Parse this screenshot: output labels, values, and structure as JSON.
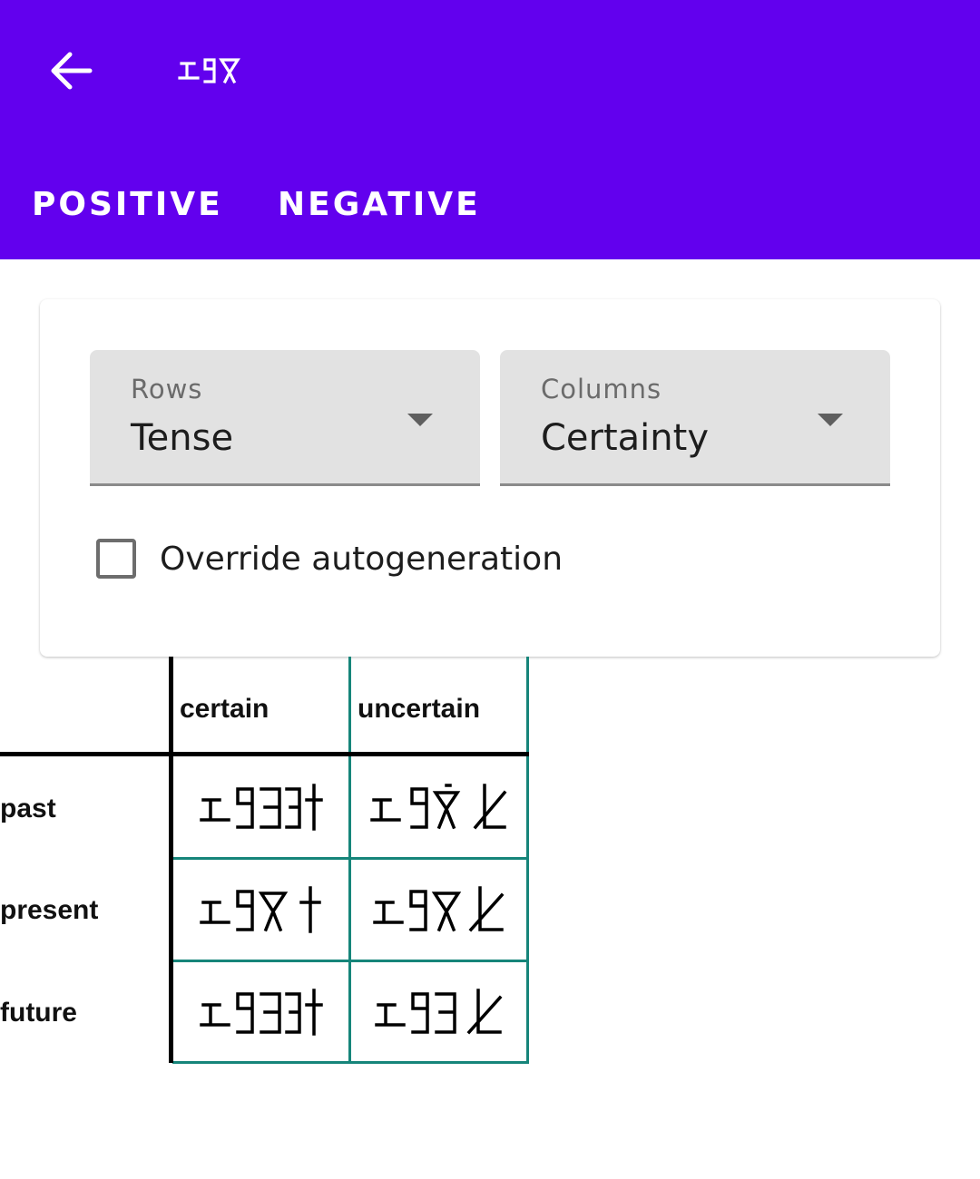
{
  "appbar": {
    "title_glyph": "ᥓᥙᥒ (script)",
    "back_icon": "arrow-back-icon",
    "color": "#6200ee"
  },
  "tabs": [
    {
      "label": "POSITIVE",
      "selected": true
    },
    {
      "label": "NEGATIVE",
      "selected": false
    }
  ],
  "settings": {
    "rows_select": {
      "label": "Rows",
      "value": "Tense"
    },
    "columns_select": {
      "label": "Columns",
      "value": "Certainty"
    },
    "override_checkbox": {
      "label": "Override autogeneration",
      "checked": false
    }
  },
  "table": {
    "column_headers": [
      "certain",
      "uncertain"
    ],
    "row_headers": [
      "past",
      "present",
      "future"
    ],
    "cells_icon_names": [
      [
        "glyph-past-certain-icon",
        "glyph-past-uncertain-icon"
      ],
      [
        "glyph-present-certain-icon",
        "glyph-present-uncertain-icon"
      ],
      [
        "glyph-future-certain-icon",
        "glyph-future-uncertain-icon"
      ]
    ],
    "border_color": "#16857a"
  }
}
